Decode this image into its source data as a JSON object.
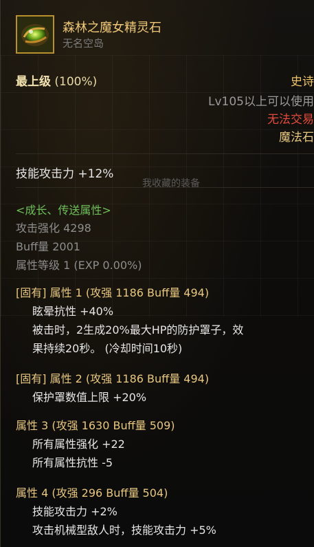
{
  "item": {
    "name": "森林之魔女精灵石",
    "source": "无名空岛",
    "icon": "green-crystal-gem-icon"
  },
  "grade": {
    "label": "最上级",
    "value": "(100%)"
  },
  "rarity": "史诗",
  "level_req": "Lv105以上可以使用",
  "trade": "无法交易",
  "item_type": "魔法石",
  "skill_attack": "技能攻击力  +12%",
  "overlay_text": "我收藏的装备",
  "growth": {
    "header": "<成长、传送属性>",
    "lines": [
      "攻击强化 4298",
      "Buff量 2001",
      "属性等级 1 (EXP 0.00%)"
    ]
  },
  "options": [
    {
      "title": "[固有] 属性 1 (攻强 1186    Buff量 494)",
      "lines": [
        "眩晕抗性 +40%",
        "被击时，2生成20%最大HP的防护罩子，效",
        "果持续20秒。 (冷却时间10秒)"
      ]
    },
    {
      "title": "[固有] 属性 2 (攻强 1186    Buff量 494)",
      "lines": [
        "保护罩数值上限 +20%"
      ]
    },
    {
      "title": "属性 3 (攻强 1630    Buff量 509)",
      "lines": [
        "所有属性强化 +22",
        "所有属性抗性 -5"
      ]
    },
    {
      "title": "属性 4 (攻强 296    Buff量 504)",
      "lines": [
        "技能攻击力 +2%",
        "攻击机械型敌人时，技能攻击力 +5%"
      ]
    }
  ],
  "colors": {
    "name": "#f0c878",
    "rarity": "#f0c46a",
    "trade": "#e24b3b",
    "growth": "#6fbf5a",
    "option_title": "#e8c881"
  }
}
